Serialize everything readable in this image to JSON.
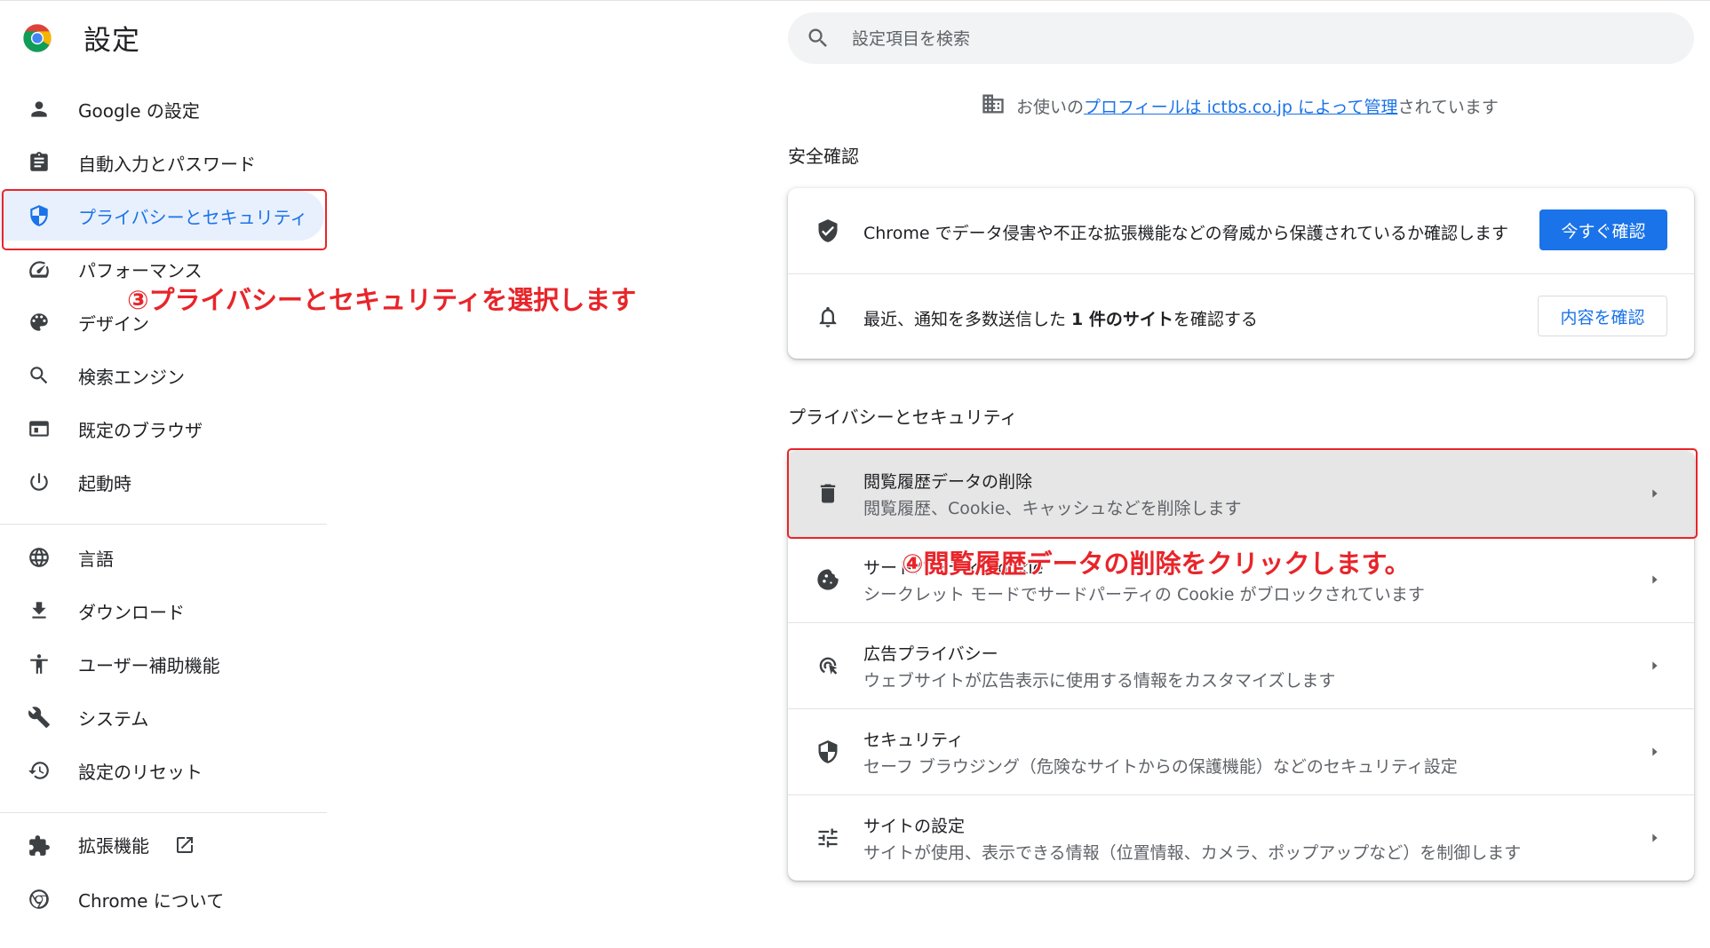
{
  "header": {
    "title": "設定",
    "logo_icon": "chrome-logo-icon"
  },
  "search": {
    "placeholder": "設定項目を検索",
    "value": ""
  },
  "sidebar": {
    "items": [
      {
        "label": "Google の設定",
        "icon": "person-icon"
      },
      {
        "label": "自動入力とパスワード",
        "icon": "clipboard-icon"
      },
      {
        "label": "プライバシーとセキュリティ",
        "icon": "shield-icon",
        "active": true
      },
      {
        "label": "パフォーマンス",
        "icon": "speedometer-icon"
      },
      {
        "label": "デザイン",
        "icon": "palette-icon"
      },
      {
        "label": "検索エンジン",
        "icon": "search-icon"
      },
      {
        "label": "既定のブラウザ",
        "icon": "browser-icon"
      },
      {
        "label": "起動時",
        "icon": "power-icon"
      },
      {
        "label": "言語",
        "icon": "globe-icon"
      },
      {
        "label": "ダウンロード",
        "icon": "download-icon"
      },
      {
        "label": "ユーザー補助機能",
        "icon": "accessibility-icon"
      },
      {
        "label": "システム",
        "icon": "wrench-icon"
      },
      {
        "label": "設定のリセット",
        "icon": "history-icon"
      },
      {
        "label": "拡張機能",
        "icon": "puzzle-icon"
      },
      {
        "label": "Chrome について",
        "icon": "chrome-icon"
      }
    ]
  },
  "managed_notice": {
    "prefix": "お使いの",
    "link": "プロフィールは ictbs.co.jp によって管理",
    "suffix": "されています"
  },
  "safety_check": {
    "heading": "安全確認",
    "rows": [
      {
        "text": "Chrome でデータ侵害や不正な拡張機能などの脅威から保護されているか確認します",
        "button": "今すぐ確認"
      },
      {
        "text_before": "最近、通知を多数送信した ",
        "text_bold": "1 件のサイト",
        "text_after": "を確認する",
        "button": "内容を確認"
      }
    ]
  },
  "privacy": {
    "heading": "プライバシーとセキュリティ",
    "rows": [
      {
        "title": "閲覧履歴データの削除",
        "subtitle": "閲覧履歴、Cookie、キャッシュなどを削除します",
        "icon": "trash-icon"
      },
      {
        "title": "サードパーティ Cookie",
        "subtitle": "シークレット モードでサードパーティの Cookie がブロックされています",
        "icon": "cookie-icon"
      },
      {
        "title": "広告プライバシー",
        "subtitle": "ウェブサイトが広告表示に使用する情報をカスタマイズします",
        "icon": "ad-privacy-icon"
      },
      {
        "title": "セキュリティ",
        "subtitle": "セーフ ブラウジング（危険なサイトからの保護機能）などのセキュリティ設定",
        "icon": "shield-half-icon"
      },
      {
        "title": "サイトの設定",
        "subtitle": "サイトが使用、表示できる情報（位置情報、カメラ、ポップアップなど）を制御します",
        "icon": "tune-icon"
      }
    ]
  },
  "annotations": {
    "step3": "③プライバシーとセキュリティを選択します",
    "step4": "④閲覧履歴データの削除をクリックします。",
    "color": "#e8252a"
  },
  "colors": {
    "accent": "#1a73e8",
    "active_bg": "#e8f0fe",
    "annotation": "#e8252a"
  }
}
